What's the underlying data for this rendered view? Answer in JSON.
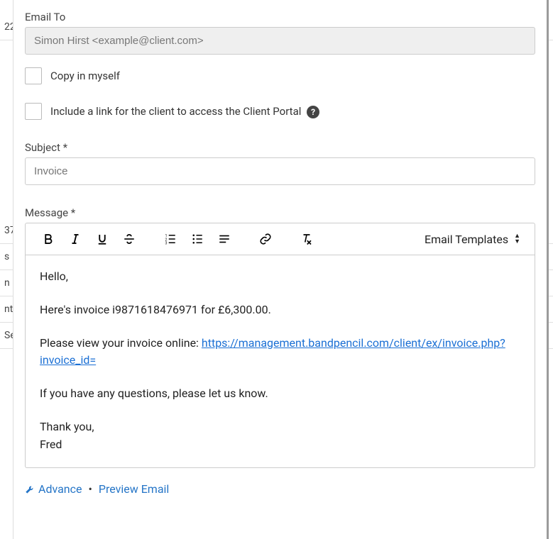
{
  "backdrop": {
    "date": "22",
    "items": [
      "37",
      "s",
      "n",
      "nt",
      "Se"
    ]
  },
  "email_to": {
    "label": "Email To",
    "value": "Simon Hirst <example@client.com>"
  },
  "copy_myself": {
    "label": "Copy in myself"
  },
  "client_portal": {
    "label": "Include a link for the client to access the Client Portal "
  },
  "subject": {
    "label": "Subject *",
    "placeholder": "Invoice"
  },
  "message": {
    "label": "Message *",
    "templates_btn": "Email Templates",
    "greeting": "Hello,",
    "invoice_line": "Here's invoice i9871618476971 for £6,300.00.",
    "view_line_prefix": "Please view your invoice online: ",
    "view_link": "https://management.bandpencil.com/client/ex/invoice.php?invoice_id=",
    "questions": "If you have any questions, please let us know.",
    "thanks": "Thank you,",
    "sender": "Fred"
  },
  "footer": {
    "advance": "Advance",
    "preview": "Preview Email",
    "sep": " • "
  }
}
